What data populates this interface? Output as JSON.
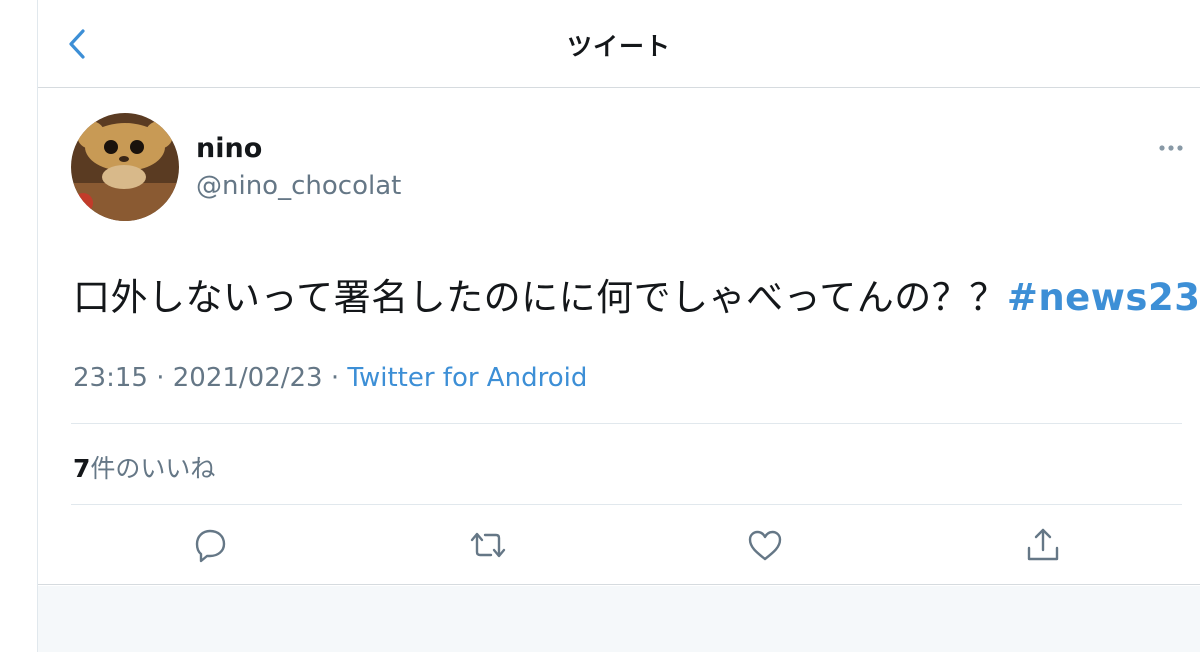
{
  "header": {
    "title": "ツイート",
    "back_icon": "chevron-left-icon"
  },
  "tweet": {
    "user": {
      "name": "nino",
      "handle": "@nino_chocolat"
    },
    "text": "口外しないって署名したのにに何でしゃべってんの？？",
    "hashtag": "#news23",
    "time": "23:15",
    "separator": " · ",
    "date": "2021/02/23",
    "source": "Twitter for Android",
    "likes_count": "7",
    "likes_label": "件のいいね"
  },
  "actions": [
    {
      "icon": "reply-icon"
    },
    {
      "icon": "retweet-icon"
    },
    {
      "icon": "like-icon"
    },
    {
      "icon": "share-icon"
    }
  ],
  "colors": {
    "link": "#3d8fd6",
    "secondary_text": "#657786",
    "icon": "#657786"
  }
}
